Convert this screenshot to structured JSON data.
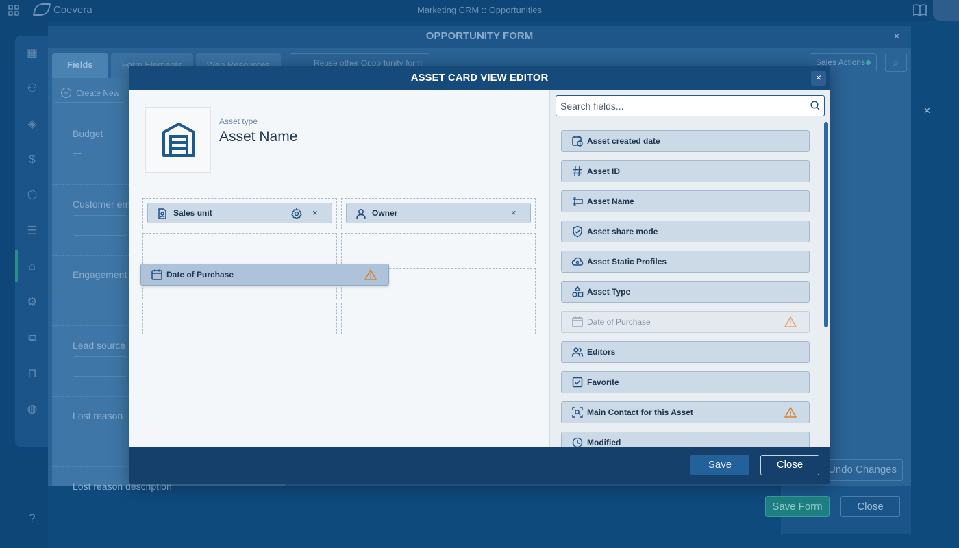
{
  "app": {
    "brand": "Coevera",
    "window_title": "Marketing CRM :: Opportunities"
  },
  "opportunity_form": {
    "title": "OPPORTUNITY FORM",
    "tabs": [
      {
        "label": "Fields",
        "active": true
      },
      {
        "label": "Form Elements",
        "active": false
      },
      {
        "label": "Web Resources",
        "active": false
      }
    ],
    "reuse_label": "Reuse other Opportunity form",
    "sales_actions_label": "Sales Actions",
    "create_new_label": "Create New",
    "fields": [
      {
        "label": "Budget",
        "kind": "checkbox"
      },
      {
        "label": "Customer em",
        "kind": "input"
      },
      {
        "label": "Engagement",
        "kind": "checkbox"
      },
      {
        "label": "Lead source",
        "kind": "input"
      },
      {
        "label": "Lost reason",
        "kind": "input"
      },
      {
        "label": "Lost reason description",
        "kind": "input"
      }
    ],
    "undo_label": "Undo Changes",
    "save_form_label": "Save Form",
    "close_label": "Close"
  },
  "editor": {
    "title": "ASSET CARD VIEW EDITOR",
    "close_x": "×",
    "asset_type_label": "Asset type",
    "asset_name": "Asset Name",
    "placed_fields": [
      {
        "label": "Sales unit",
        "icon": "building-badge-icon",
        "has_settings": true
      },
      {
        "label": "Owner",
        "icon": "person-icon",
        "has_settings": false
      }
    ],
    "dragging_field": {
      "label": "Date of Purchase",
      "icon": "calendar-icon",
      "warning": true
    },
    "search_placeholder": "Search fields...",
    "available_fields": [
      {
        "label": "Asset created date",
        "icon": "calendar-clock-icon",
        "disabled": false,
        "warning": false
      },
      {
        "label": "Asset ID",
        "icon": "hash-icon",
        "disabled": false,
        "warning": false
      },
      {
        "label": "Asset Name",
        "icon": "text-cursor-icon",
        "disabled": false,
        "warning": false
      },
      {
        "label": "Asset share mode",
        "icon": "shield-check-icon",
        "disabled": false,
        "warning": false
      },
      {
        "label": "Asset Static Profiles",
        "icon": "cloud-icon",
        "disabled": false,
        "warning": false
      },
      {
        "label": "Asset Type",
        "icon": "shapes-icon",
        "disabled": false,
        "warning": false
      },
      {
        "label": "Date of Purchase",
        "icon": "calendar-icon",
        "disabled": true,
        "warning": true
      },
      {
        "label": "Editors",
        "icon": "users-icon",
        "disabled": false,
        "warning": false
      },
      {
        "label": "Favorite",
        "icon": "checkbox-icon",
        "disabled": false,
        "warning": false
      },
      {
        "label": "Main Contact for this Asset",
        "icon": "contact-search-icon",
        "disabled": false,
        "warning": true
      },
      {
        "label": "Modified",
        "icon": "clock-icon",
        "disabled": false,
        "warning": false
      }
    ],
    "save_label": "Save",
    "close_label": "Close"
  },
  "colors": {
    "header": "#154a7b",
    "chip": "#ccd9e6",
    "warning": "#d9822b"
  }
}
